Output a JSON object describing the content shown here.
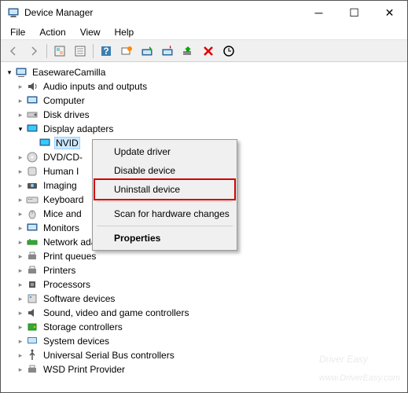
{
  "window": {
    "title": "Device Manager"
  },
  "menubar": {
    "file": "File",
    "action": "Action",
    "view": "View",
    "help": "Help"
  },
  "tree": {
    "root": "EasewareCamilla",
    "nodes": {
      "audio": "Audio inputs and outputs",
      "computer": "Computer",
      "disk": "Disk drives",
      "display": "Display adapters",
      "nvid": "NVID",
      "dvd": "DVD/CD-",
      "hid": "Human I",
      "imaging": "Imaging",
      "keyboard": "Keyboard",
      "mice": "Mice and",
      "monitors": "Monitors",
      "network": "Network adapters",
      "printq": "Print queues",
      "printers": "Printers",
      "processors": "Processors",
      "software": "Software devices",
      "sound": "Sound, video and game controllers",
      "storage": "Storage controllers",
      "system": "System devices",
      "usb": "Universal Serial Bus controllers",
      "wsd": "WSD Print Provider"
    }
  },
  "contextmenu": {
    "update": "Update driver",
    "disable": "Disable device",
    "uninstall": "Uninstall device",
    "scan": "Scan for hardware changes",
    "properties": "Properties"
  },
  "watermark": "Driver Easy",
  "watermark_url": "www.DriverEasy.com"
}
